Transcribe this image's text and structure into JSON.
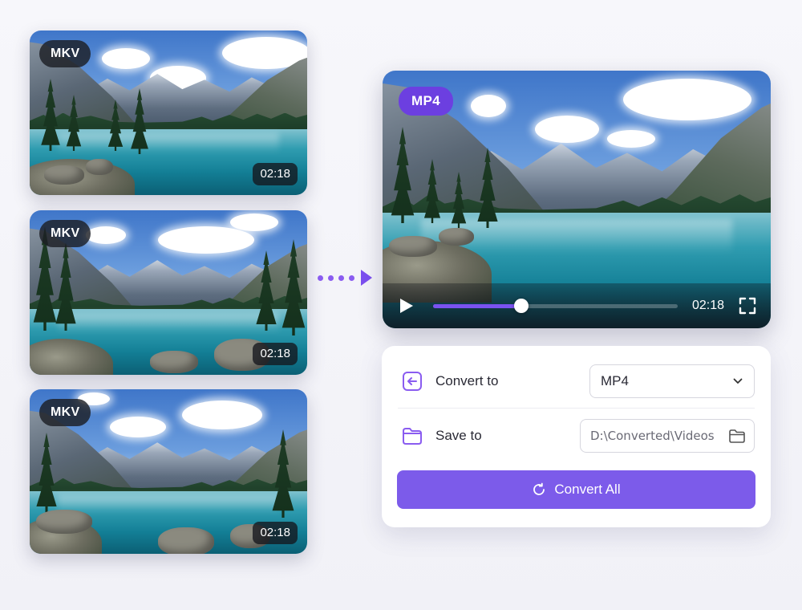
{
  "queue": [
    {
      "format": "MKV",
      "duration": "02:18"
    },
    {
      "format": "MKV",
      "duration": "02:18"
    },
    {
      "format": "MKV",
      "duration": "02:18"
    }
  ],
  "preview": {
    "format": "MP4",
    "time": "02:18",
    "progress": 0.36
  },
  "settings": {
    "convert_to_label": "Convert to",
    "convert_to_value": "MP4",
    "save_to_label": "Save to",
    "save_to_value": "D:\\Converted\\Videos"
  },
  "actions": {
    "convert_all_label": "Convert All"
  },
  "colors": {
    "accent": "#7c5bea",
    "accent_dark": "#6c3fe0"
  }
}
